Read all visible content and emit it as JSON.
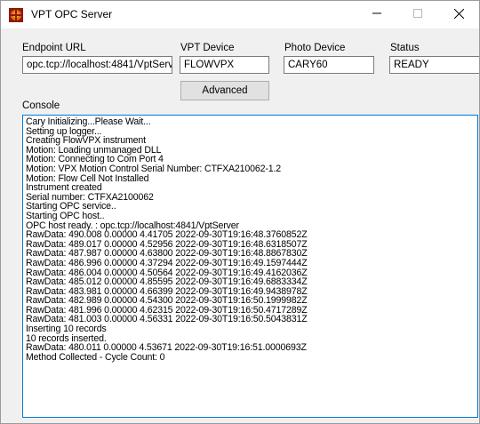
{
  "window": {
    "title": "VPT OPC Server",
    "minimize_glyph": "—",
    "maximize_glyph": "☐",
    "close_glyph": "✕"
  },
  "fields": {
    "endpoint_label": "Endpoint URL",
    "endpoint_value": "opc.tcp://localhost:4841/VptServ",
    "vpt_label": "VPT Device",
    "vpt_value": "FLOWVPX",
    "photo_label": "Photo Device",
    "photo_value": "CARY60",
    "status_label": "Status",
    "status_value": "READY"
  },
  "advanced_label": "Advanced",
  "console": {
    "label": "Console",
    "lines": [
      "Cary Initializing...Please Wait...",
      "Setting up logger...",
      "Creating FlowVPX instrument",
      "Motion: Loading unmanaged DLL",
      "Motion: Connecting to Com Port 4",
      "Motion: VPX Motion Control Serial Number: CTFXA210062-1.2",
      "Motion: Flow Cell Not Installed",
      "Instrument created",
      "Serial number: CTFXA2100062",
      "Starting OPC service..",
      "Starting OPC host..",
      "OPC host ready. : opc.tcp://localhost:4841/VptServer",
      "RawData: 490.008 0.00000 4.41705 2022-09-30T19:16:48.3760852Z",
      "RawData: 489.017 0.00000 4.52956 2022-09-30T19:16:48.6318507Z",
      "RawData: 487.987 0.00000 4.63800 2022-09-30T19:16:48.8867830Z",
      "RawData: 486.996 0.00000 4.37294 2022-09-30T19:16:49.1597444Z",
      "RawData: 486.004 0.00000 4.50564 2022-09-30T19:16:49.4162036Z",
      "RawData: 485.012 0.00000 4.85595 2022-09-30T19:16:49.6883334Z",
      "RawData: 483.981 0.00000 4.66399 2022-09-30T19:16:49.9438978Z",
      "RawData: 482.989 0.00000 4.54300 2022-09-30T19:16:50.1999982Z",
      "RawData: 481.996 0.00000 4.62315 2022-09-30T19:16:50.4717289Z",
      "RawData: 481.003 0.00000 4.56331 2022-09-30T19:16:50.5043831Z",
      "Inserting 10 records",
      "10 records inserted.",
      "RawData: 480.011 0.00000 4.53671 2022-09-30T19:16:51.0000693Z",
      "Method Collected - Cycle Count: 0"
    ]
  },
  "colors": {
    "console_border": "#0078d7",
    "icon_orange": "#e8730c",
    "icon_yellow": "#f5c400"
  },
  "icons": {
    "app": "opc-server-app-icon",
    "minimize": "minimize-icon",
    "maximize": "maximize-icon",
    "close": "close-icon"
  }
}
